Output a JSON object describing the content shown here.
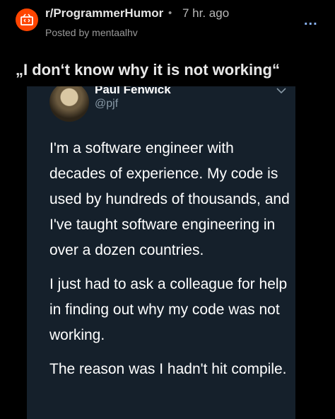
{
  "post": {
    "subreddit": "r/ProgrammerHumor",
    "separator": "•",
    "time_ago": "7 hr. ago",
    "posted_by": "Posted by mentaalhv",
    "more_label": "...",
    "title": "„I don‘t know why it is not working“"
  },
  "tweet": {
    "display_name": "Paul Fenwick",
    "handle": "@pjf",
    "paragraphs": [
      "I'm a software engineer with decades of experience. My code is used by hundreds of thousands, and I've taught software engineering in over a dozen countries.",
      "I just had to ask a colleague for help in finding out why my code was not working.",
      "The reason was I hadn't hit compile."
    ]
  },
  "colors": {
    "background": "#000000",
    "card": "#15202b",
    "subreddit_icon": "#ff4500",
    "more_icon": "#8ab4f8"
  },
  "icons": {
    "subreddit": "subreddit-icon",
    "more": "more-options-icon",
    "chevron": "chevron-down-icon"
  }
}
